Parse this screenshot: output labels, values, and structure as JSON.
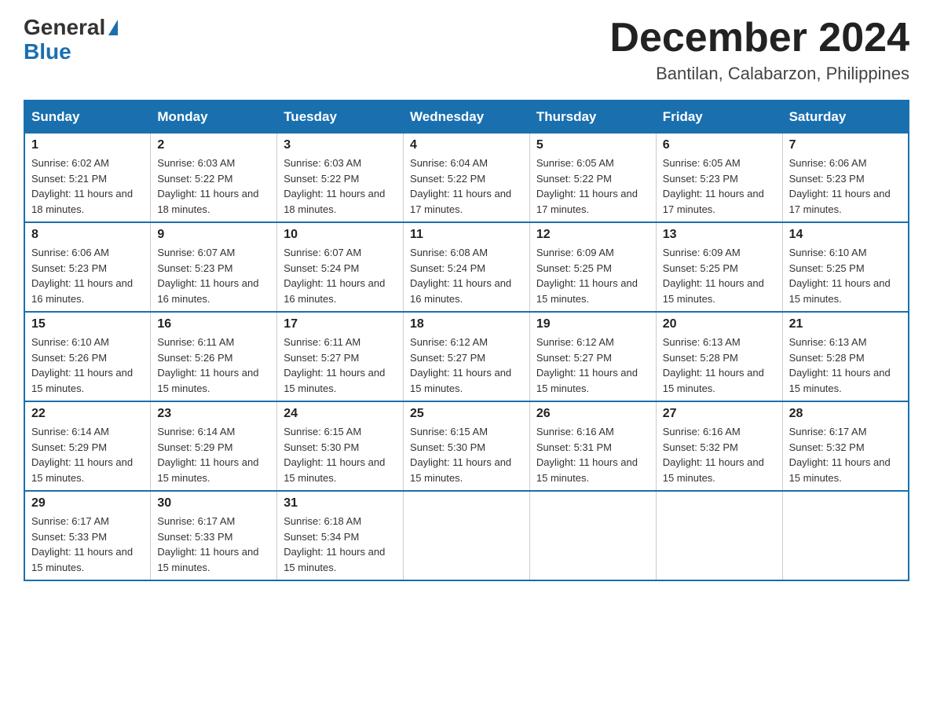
{
  "logo": {
    "general": "General",
    "blue": "Blue",
    "tagline": "General Blue"
  },
  "header": {
    "month_title": "December 2024",
    "location": "Bantilan, Calabarzon, Philippines"
  },
  "days_of_week": [
    "Sunday",
    "Monday",
    "Tuesday",
    "Wednesday",
    "Thursday",
    "Friday",
    "Saturday"
  ],
  "weeks": [
    [
      {
        "day": "1",
        "sunrise": "6:02 AM",
        "sunset": "5:21 PM",
        "daylight": "11 hours and 18 minutes."
      },
      {
        "day": "2",
        "sunrise": "6:03 AM",
        "sunset": "5:22 PM",
        "daylight": "11 hours and 18 minutes."
      },
      {
        "day": "3",
        "sunrise": "6:03 AM",
        "sunset": "5:22 PM",
        "daylight": "11 hours and 18 minutes."
      },
      {
        "day": "4",
        "sunrise": "6:04 AM",
        "sunset": "5:22 PM",
        "daylight": "11 hours and 17 minutes."
      },
      {
        "day": "5",
        "sunrise": "6:05 AM",
        "sunset": "5:22 PM",
        "daylight": "11 hours and 17 minutes."
      },
      {
        "day": "6",
        "sunrise": "6:05 AM",
        "sunset": "5:23 PM",
        "daylight": "11 hours and 17 minutes."
      },
      {
        "day": "7",
        "sunrise": "6:06 AM",
        "sunset": "5:23 PM",
        "daylight": "11 hours and 17 minutes."
      }
    ],
    [
      {
        "day": "8",
        "sunrise": "6:06 AM",
        "sunset": "5:23 PM",
        "daylight": "11 hours and 16 minutes."
      },
      {
        "day": "9",
        "sunrise": "6:07 AM",
        "sunset": "5:23 PM",
        "daylight": "11 hours and 16 minutes."
      },
      {
        "day": "10",
        "sunrise": "6:07 AM",
        "sunset": "5:24 PM",
        "daylight": "11 hours and 16 minutes."
      },
      {
        "day": "11",
        "sunrise": "6:08 AM",
        "sunset": "5:24 PM",
        "daylight": "11 hours and 16 minutes."
      },
      {
        "day": "12",
        "sunrise": "6:09 AM",
        "sunset": "5:25 PM",
        "daylight": "11 hours and 15 minutes."
      },
      {
        "day": "13",
        "sunrise": "6:09 AM",
        "sunset": "5:25 PM",
        "daylight": "11 hours and 15 minutes."
      },
      {
        "day": "14",
        "sunrise": "6:10 AM",
        "sunset": "5:25 PM",
        "daylight": "11 hours and 15 minutes."
      }
    ],
    [
      {
        "day": "15",
        "sunrise": "6:10 AM",
        "sunset": "5:26 PM",
        "daylight": "11 hours and 15 minutes."
      },
      {
        "day": "16",
        "sunrise": "6:11 AM",
        "sunset": "5:26 PM",
        "daylight": "11 hours and 15 minutes."
      },
      {
        "day": "17",
        "sunrise": "6:11 AM",
        "sunset": "5:27 PM",
        "daylight": "11 hours and 15 minutes."
      },
      {
        "day": "18",
        "sunrise": "6:12 AM",
        "sunset": "5:27 PM",
        "daylight": "11 hours and 15 minutes."
      },
      {
        "day": "19",
        "sunrise": "6:12 AM",
        "sunset": "5:27 PM",
        "daylight": "11 hours and 15 minutes."
      },
      {
        "day": "20",
        "sunrise": "6:13 AM",
        "sunset": "5:28 PM",
        "daylight": "11 hours and 15 minutes."
      },
      {
        "day": "21",
        "sunrise": "6:13 AM",
        "sunset": "5:28 PM",
        "daylight": "11 hours and 15 minutes."
      }
    ],
    [
      {
        "day": "22",
        "sunrise": "6:14 AM",
        "sunset": "5:29 PM",
        "daylight": "11 hours and 15 minutes."
      },
      {
        "day": "23",
        "sunrise": "6:14 AM",
        "sunset": "5:29 PM",
        "daylight": "11 hours and 15 minutes."
      },
      {
        "day": "24",
        "sunrise": "6:15 AM",
        "sunset": "5:30 PM",
        "daylight": "11 hours and 15 minutes."
      },
      {
        "day": "25",
        "sunrise": "6:15 AM",
        "sunset": "5:30 PM",
        "daylight": "11 hours and 15 minutes."
      },
      {
        "day": "26",
        "sunrise": "6:16 AM",
        "sunset": "5:31 PM",
        "daylight": "11 hours and 15 minutes."
      },
      {
        "day": "27",
        "sunrise": "6:16 AM",
        "sunset": "5:32 PM",
        "daylight": "11 hours and 15 minutes."
      },
      {
        "day": "28",
        "sunrise": "6:17 AM",
        "sunset": "5:32 PM",
        "daylight": "11 hours and 15 minutes."
      }
    ],
    [
      {
        "day": "29",
        "sunrise": "6:17 AM",
        "sunset": "5:33 PM",
        "daylight": "11 hours and 15 minutes."
      },
      {
        "day": "30",
        "sunrise": "6:17 AM",
        "sunset": "5:33 PM",
        "daylight": "11 hours and 15 minutes."
      },
      {
        "day": "31",
        "sunrise": "6:18 AM",
        "sunset": "5:34 PM",
        "daylight": "11 hours and 15 minutes."
      },
      null,
      null,
      null,
      null
    ]
  ]
}
